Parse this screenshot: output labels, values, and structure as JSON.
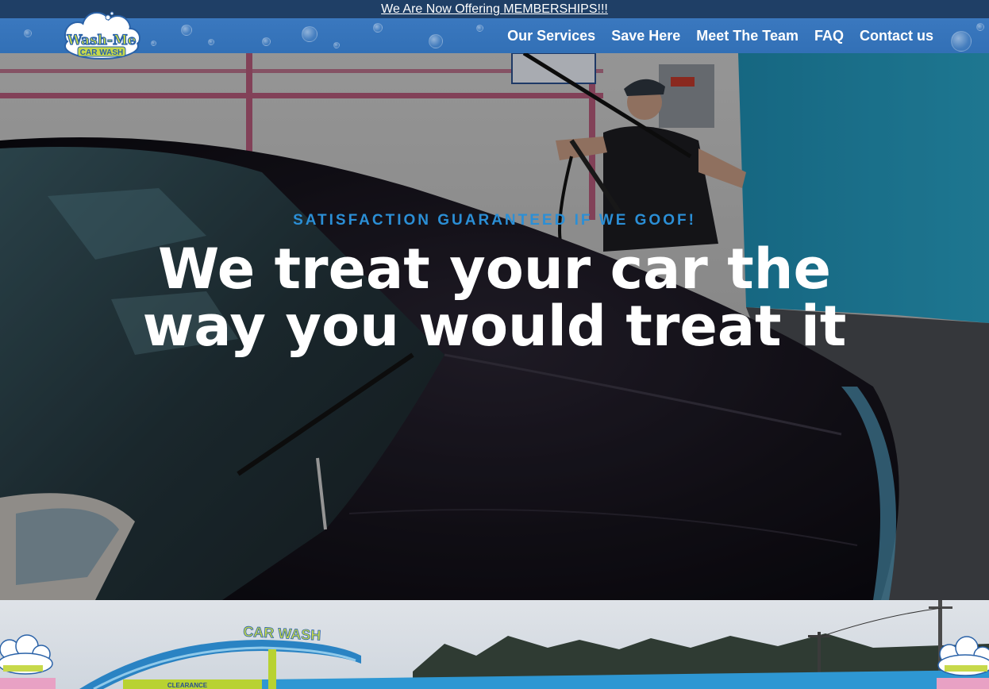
{
  "announcement": {
    "text": "We Are Now Offering MEMBERSHIPS!!!"
  },
  "brand": {
    "line1": "Wash-Me",
    "line2": "CAR WASH"
  },
  "nav": {
    "items": [
      {
        "label": "Our Services"
      },
      {
        "label": "Save Here"
      },
      {
        "label": "Meet The Team"
      },
      {
        "label": "FAQ"
      },
      {
        "label": "Contact us"
      }
    ]
  },
  "hero": {
    "eyebrow": "SATISFACTION GUARANTEED IF WE GOOF!",
    "headline_line1": "We treat your car the",
    "headline_line2": "way you would treat it"
  },
  "building": {
    "sign": "CAR WASH",
    "banner": "CLEARANCE"
  },
  "colors": {
    "announcement_bg": "#1f3f66",
    "header_bg": "#3a78bf",
    "eyebrow": "#2b8fd6",
    "headline": "#ffffff"
  }
}
